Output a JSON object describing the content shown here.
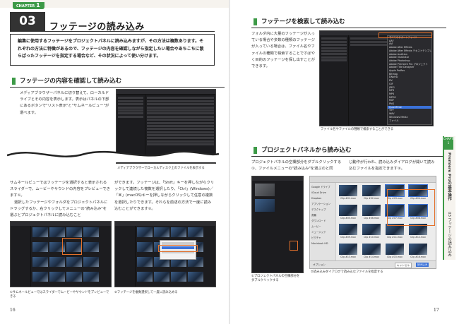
{
  "left_page": {
    "chapter_label": "CHAPTER",
    "chapter_number": "1",
    "section_number": "03",
    "section_title": "フッテージの読み込み",
    "intro": "編集に使用するフッテージをプロジェクトパネルに読み込みますが、その方法は複数あります。それぞれの方法に特徴があるので、フッテージの内容を確認しながら指定したい場合やあちこちに散らばったフッテージを指定する場合など、その状況によって使い分けます。",
    "heading1": "フッテージの内容を確認して読み込む",
    "para1": "メディアブラウザーパネルに切り替えて、ローカルドライブとその内容を表示します。表示はパネルの下部にあるボタンで\"リスト表示\"と\"サムネールビュー\"が選べます。",
    "caption1": "メディアブラウザーでローカルディスク上のファイルを表示する",
    "para2a": "サムネールビューではフッテージを選択すると表示されるスライダーで、ムービーやサウンドの内容をプレビューできます①。",
    "para2b": "選択したフッテージやフォルダをプロジェクトパネルにドラッグするか、右クリックしてメニューの\"読み込み\"を選ぶとプロジェクトパネルに読み込むこと",
    "para3": "ができます。フッテージは、「Shift」キーを押しながらクリックして連続した複数を選択したり、「Ctrl」(Windows)／「⌘」(macOS)キーを押しながらクリックして任意の複数を選択したりできます。それらを前述の方法で一度に読み込むことができます②。",
    "caption2": "①サムネールビューではスライダーでムービーやサウンドをプレビューできる",
    "caption3": "②フッテージを複数選択して一度に読み込める",
    "page_number": "16"
  },
  "right_page": {
    "heading1": "フッテージを検索して読み込む",
    "para1": "フォルダ内に大量のフッテージが入っている場合や多数の種類のフッテージが入っている場合は、ファイル名やファイルの種類で検索することですばやく目的のフッテージを探し出すことができます。",
    "caption1": "ファイル名やファイルの種類で検索することができる",
    "heading2": "プロジェクトパネルから読み込む",
    "para2": "プロジェクトパネルの空欄部分をダブルクリックする①、ファイルメニューの\"読み込み\"を選ぶのと同じ動作が行われ、読み込みダイアログが開いて読み込むファイルを指定できます②。",
    "caption2": "①プロジェクトパネルの空欄部分をダブルクリックする",
    "caption3": "②読み込みダイアログで読み込むファイルを指定する",
    "page_number": "17",
    "side_chapter": "CHAPTER 1",
    "side_title": "Premiere Proの基本操作",
    "side_section": "03 フッテージの読み込み"
  },
  "accent": "#3d9a47",
  "highlight": "#e4712b",
  "dropdown_items": [
    "すべてのサポートファイル",
    "AAF",
    "AVI",
    "Adobe After Effects",
    "Adobe After Effects テキストテンプレート",
    "Adobe Audition",
    "Adobe Illustrator",
    "Adobe Photoshop",
    "Adobe Premiere Pro プロジェクト",
    "Adobe Title Designer",
    "Apple ProRes",
    "Bitmap",
    "DNxHD",
    "DV",
    "GIF",
    "JPEG",
    "MP3",
    "MP4",
    "MPEG",
    "MXF",
    "PNG",
    "QuickTime",
    "TIFF",
    "WAV",
    "Windows Media",
    "ファイル"
  ],
  "dialog_sidebar": [
    "Google ドライブ",
    "iCloud Drive",
    "Dropbox",
    "アプリケーション",
    "デスクトップ",
    "書類",
    "ダウンロード",
    "ムービー",
    "ミュージック",
    "ピクチャ",
    "Macintosh HD"
  ],
  "dialog_files": [
    "Clip #01.mov",
    "Clip #02.mov",
    "Clip #03.mov",
    "Clip #04.mov",
    "Clip #05.mov",
    "Clip #06.mov",
    "Clip #07.mov",
    "Clip #08.mov",
    "Clip #09.mov",
    "Clip #10.mov",
    "Clip #11.mov",
    "Clip #12.mov",
    "Clip #13.mov",
    "Clip #14.mov",
    "Clip #15.mov",
    "Clip #16.mov"
  ],
  "dialog_buttons": {
    "options": "オプション",
    "cancel": "キャンセル",
    "open": "読み込み"
  }
}
